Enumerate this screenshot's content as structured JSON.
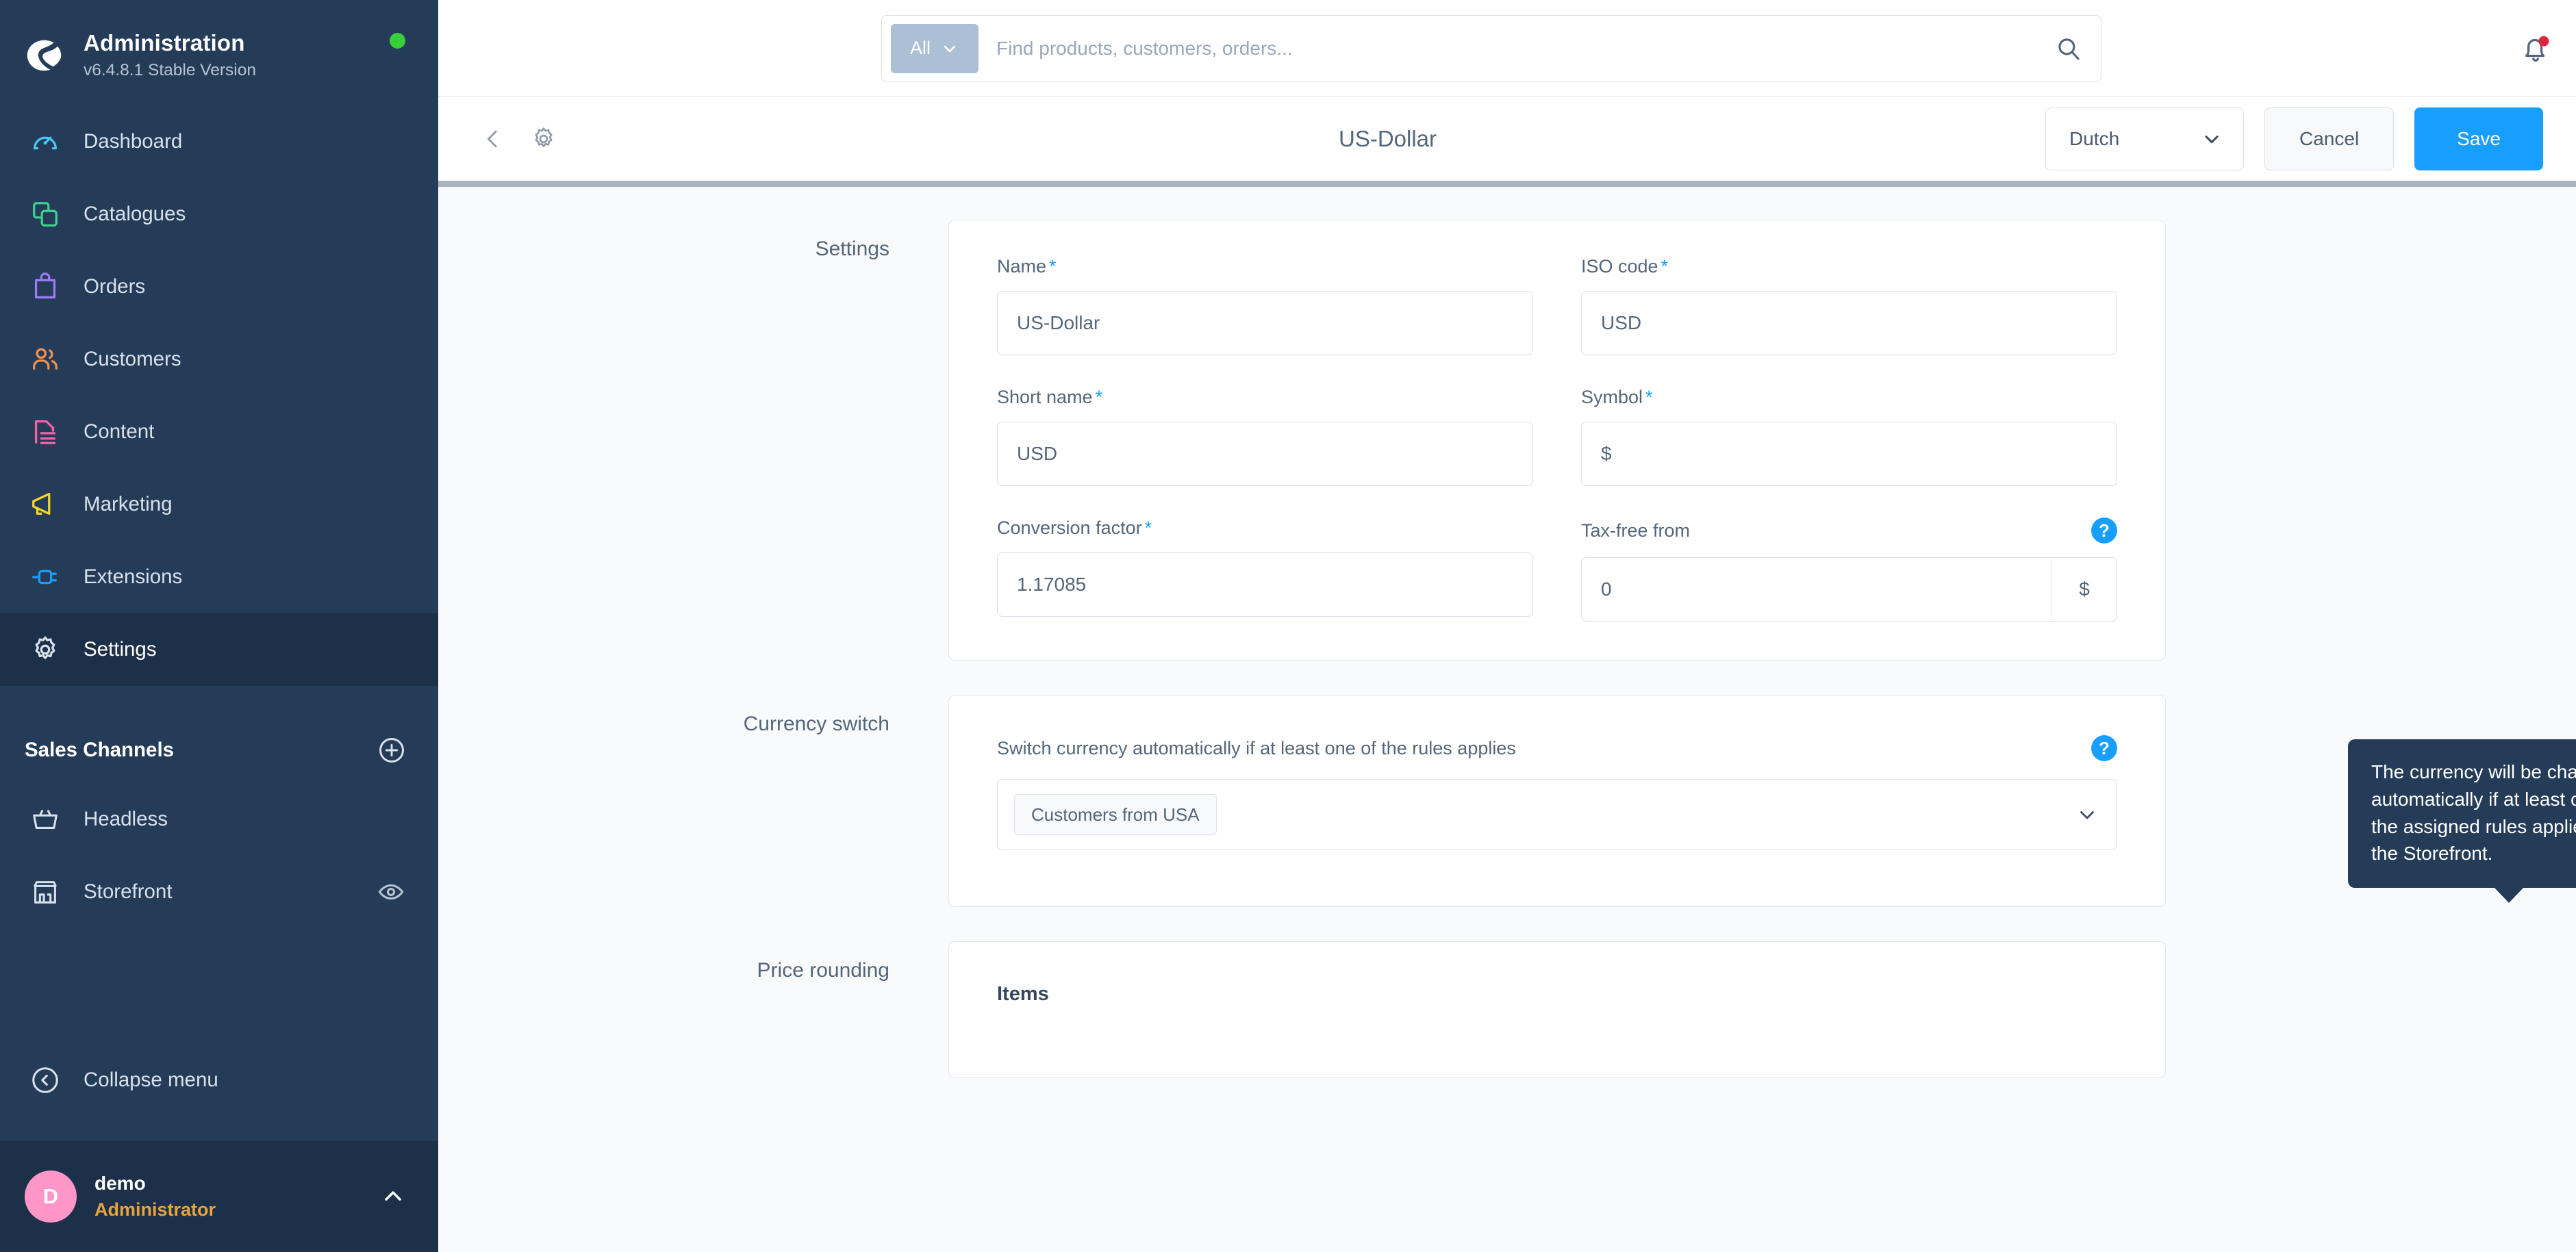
{
  "brand": {
    "title": "Administration",
    "version": "v6.4.8.1 Stable Version",
    "logo_icon": "shopware-logo-icon",
    "status_icon": "online-status-dot"
  },
  "sidebar": {
    "items": [
      {
        "label": "Dashboard",
        "icon": "gauge-icon",
        "color": "#49c8f2",
        "active": false
      },
      {
        "label": "Catalogues",
        "icon": "layers-icon",
        "color": "#3fcf8e",
        "active": false
      },
      {
        "label": "Orders",
        "icon": "bag-icon",
        "color": "#9e7bf5",
        "active": false
      },
      {
        "label": "Customers",
        "icon": "users-icon",
        "color": "#f09152",
        "active": false
      },
      {
        "label": "Content",
        "icon": "document-icon",
        "color": "#f862a8",
        "active": false
      },
      {
        "label": "Marketing",
        "icon": "megaphone-icon",
        "color": "#f5d528",
        "active": false
      },
      {
        "label": "Extensions",
        "icon": "plug-icon",
        "color": "#189eff",
        "active": false
      },
      {
        "label": "Settings",
        "icon": "gear-icon",
        "color": "#d8e0ea",
        "active": true
      }
    ],
    "sales_channels": {
      "title": "Sales Channels",
      "add_icon": "plus-circle-icon",
      "items": [
        {
          "label": "Headless",
          "icon": "basket-icon",
          "trailing_icon": ""
        },
        {
          "label": "Storefront",
          "icon": "storefront-icon",
          "trailing_icon": "eye-icon"
        }
      ]
    },
    "collapse": {
      "label": "Collapse menu",
      "icon": "chevron-left-circle-icon"
    },
    "user": {
      "avatar_initial": "D",
      "name": "demo",
      "role": "Administrator",
      "caret_icon": "chevron-up-icon",
      "avatar_color": "#ff96c8",
      "role_color": "#e8a33d"
    }
  },
  "topbar": {
    "search": {
      "scope_label": "All",
      "scope_caret_icon": "chevron-down-icon",
      "placeholder": "Find products, customers, orders...",
      "value": "",
      "submit_icon": "search-icon"
    },
    "notifications": {
      "icon": "bell-icon",
      "has_unread": true,
      "badge_color": "#e2233f"
    }
  },
  "page_header": {
    "back_icon": "chevron-left-icon",
    "settings_icon": "gear-icon",
    "title": "US-Dollar",
    "language": {
      "value": "Dutch",
      "caret_icon": "chevron-down-icon"
    },
    "cancel_label": "Cancel",
    "save_label": "Save",
    "save_color": "#189eff"
  },
  "sections": {
    "settings": {
      "label": "Settings",
      "fields": {
        "name": {
          "label": "Name",
          "required": true,
          "value": "US-Dollar"
        },
        "iso_code": {
          "label": "ISO code",
          "required": true,
          "value": "USD"
        },
        "short_name": {
          "label": "Short name",
          "required": true,
          "value": "USD"
        },
        "symbol": {
          "label": "Symbol",
          "required": true,
          "value": "$"
        },
        "conversion": {
          "label": "Conversion factor",
          "required": true,
          "value": "1.17085"
        },
        "tax_free": {
          "label": "Tax-free from",
          "required": false,
          "value": "0",
          "suffix": "$",
          "help_icon": "help-circle-icon"
        }
      },
      "required_marker": "*"
    },
    "currency_switch": {
      "label": "Currency switch",
      "switch_label": "Switch currency automatically if at least one of the rules applies",
      "help_icon": "help-circle-icon",
      "rules": [
        "Customers from USA"
      ],
      "caret_icon": "chevron-down-icon"
    },
    "price_rounding": {
      "label": "Price rounding",
      "items_title": "Items"
    }
  },
  "tooltip": {
    "text": "The currency will be changed automatically if at least one of the assigned rules applies at the Storefront."
  }
}
